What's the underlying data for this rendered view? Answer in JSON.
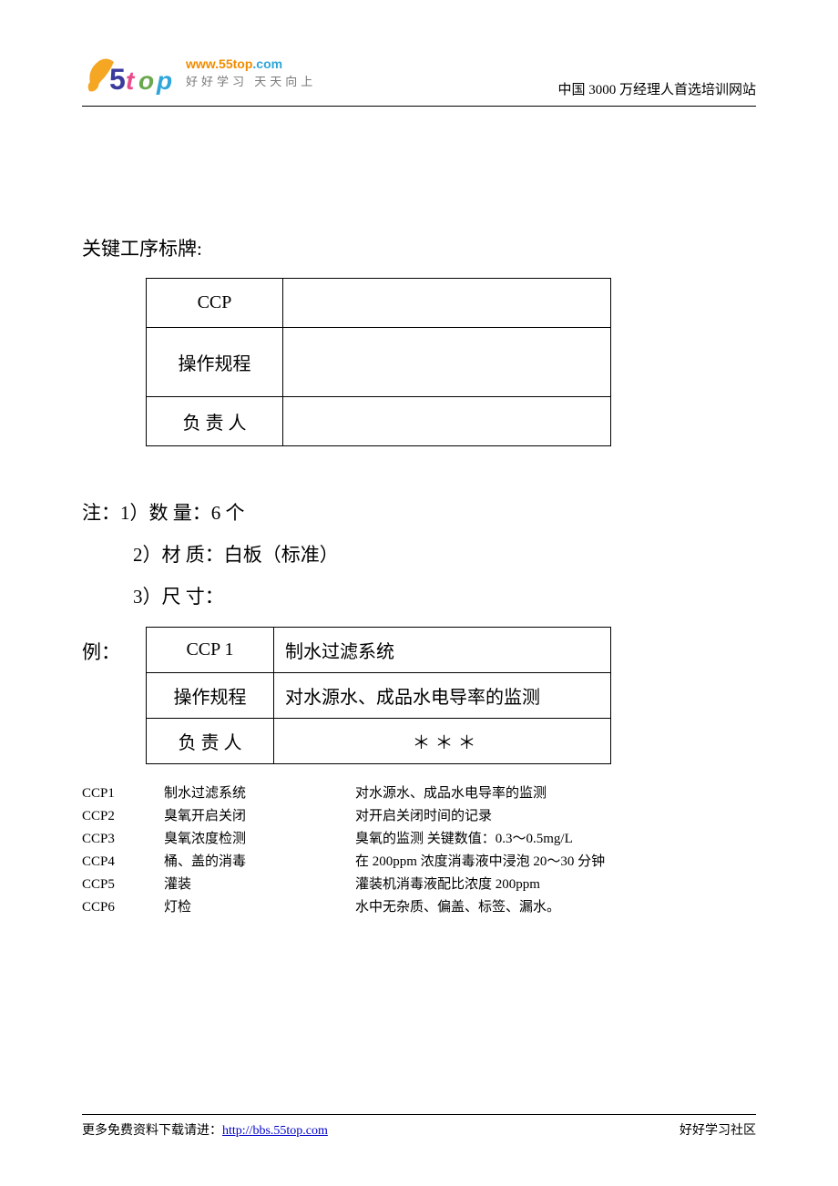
{
  "header": {
    "logo_url_1": "www.55top",
    "logo_url_2": ".com",
    "logo_slogan": "好好学习  天天向上",
    "right_text": "中国 3000 万经理人首选培训网站"
  },
  "section_title": "关键工序标牌:",
  "table1": {
    "row1": {
      "label": "CCP",
      "value": ""
    },
    "row2": {
      "label": "操作规程",
      "value": ""
    },
    "row3": {
      "label": "负 责 人",
      "value": ""
    }
  },
  "notes": {
    "line1": "注：1）数 量：6 个",
    "line2": "2）材 质：白板（标准）",
    "line3": "3）尺 寸："
  },
  "example_label": "例：",
  "table2": {
    "row1": {
      "label": "CCP 1",
      "value": "制水过滤系统"
    },
    "row2": {
      "label": "操作规程",
      "value": "对水源水、成品水电导率的监测"
    },
    "row3": {
      "label": "负 责 人",
      "value": "＊  ＊  ＊"
    }
  },
  "ccp_list": [
    {
      "id": "CCP1",
      "name": "制水过滤系统",
      "desc": "对水源水、成品水电导率的监测"
    },
    {
      "id": "CCP2",
      "name": "臭氧开启关闭",
      "desc": "对开启关闭时间的记录"
    },
    {
      "id": "CCP3",
      "name": "臭氧浓度检测",
      "desc": "臭氧的监测    关键数值：0.3～0.5mg/L"
    },
    {
      "id": "CCP4",
      "name": "桶、盖的消毒",
      "desc": "在 200ppm 浓度消毒液中浸泡 20～30 分钟"
    },
    {
      "id": "CCP5",
      "name": "灌装",
      "desc": "灌装机消毒液配比浓度 200ppm"
    },
    {
      "id": "CCP6",
      "name": "灯检",
      "desc": "水中无杂质、偏盖、标签、漏水。"
    }
  ],
  "footer": {
    "left_prefix": "更多免费资料下载请进：",
    "left_link": "http://bbs.55top.com",
    "right": "好好学习社区"
  }
}
